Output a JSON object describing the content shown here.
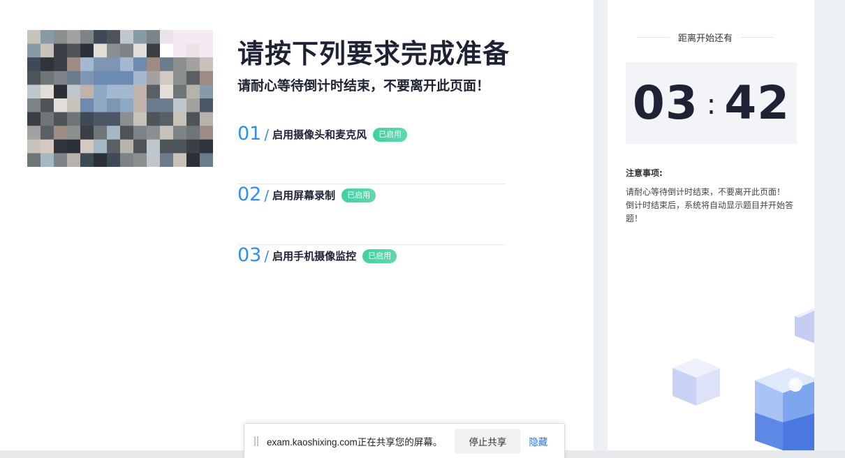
{
  "main": {
    "title": "请按下列要求完成准备",
    "subtitle": "请耐心等待倒计时结束，不要离开此页面！",
    "camera_preview": "camera-feed",
    "steps": [
      {
        "num": "01",
        "sep": "/",
        "label": "启用摄像头和麦克风",
        "status": "已启用"
      },
      {
        "num": "02",
        "sep": "/",
        "label": "启用屏幕录制",
        "status": "已启用"
      },
      {
        "num": "03",
        "sep": "/",
        "label": "启用手机摄像监控",
        "status": "已启用"
      }
    ]
  },
  "sidebar": {
    "countdown_heading": "距离开始还有",
    "timer": {
      "minutes": "03",
      "colon": ":",
      "seconds": "42"
    },
    "notice_title": "注意事项:",
    "notice_line1": "请耐心等待倒计时结束，不要离开此页面！",
    "notice_line2": "倒计时结束后，系统将自动显示题目并开始答题！"
  },
  "share_bar": {
    "text": "exam.kaoshixing.com正在共享您的屏幕。",
    "stop_label": "停止共享",
    "hide_label": "隐藏"
  },
  "colors": {
    "accent": "#2f8ff1",
    "badge": "#3ed1a2",
    "link": "#1a73e8"
  }
}
